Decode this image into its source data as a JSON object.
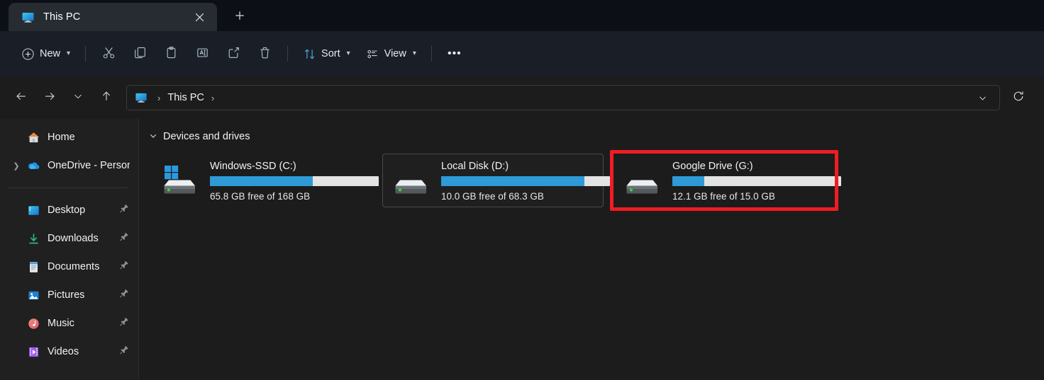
{
  "window": {
    "tab_title": "This PC",
    "tab_icon": "this-pc-monitor-icon",
    "close_icon": "close-icon",
    "new_tab_icon": "plus-icon"
  },
  "toolbar": {
    "new_label": "New",
    "sort_label": "Sort",
    "view_label": "View",
    "buttons": [
      {
        "name": "cut-button",
        "icon": "scissors-icon"
      },
      {
        "name": "copy-button",
        "icon": "copy-icon"
      },
      {
        "name": "paste-button",
        "icon": "paste-icon"
      },
      {
        "name": "rename-button",
        "icon": "rename-icon"
      },
      {
        "name": "share-button",
        "icon": "share-icon"
      },
      {
        "name": "delete-button",
        "icon": "trash-icon"
      }
    ],
    "overflow_label": "•••"
  },
  "address_bar": {
    "back_icon": "arrow-left-icon",
    "forward_icon": "arrow-right-icon",
    "recent_icon": "chevron-down-icon",
    "up_icon": "arrow-up-icon",
    "location_icon": "this-pc-monitor-icon",
    "crumbs": [
      "This PC"
    ],
    "separator": "›",
    "dropdown_icon": "chevron-down-icon",
    "refresh_icon": "refresh-icon"
  },
  "sidebar": {
    "items": [
      {
        "label": "Home",
        "icon": "home-icon",
        "expander": false,
        "pinned": false
      },
      {
        "label": "OneDrive - Persona",
        "icon": "onedrive-cloud-icon",
        "expander": true,
        "pinned": false
      },
      {
        "divider": true
      },
      {
        "label": "Desktop",
        "icon": "desktop-icon",
        "expander": false,
        "pinned": true
      },
      {
        "label": "Downloads",
        "icon": "downloads-icon",
        "expander": false,
        "pinned": true
      },
      {
        "label": "Documents",
        "icon": "documents-icon",
        "expander": false,
        "pinned": true
      },
      {
        "label": "Pictures",
        "icon": "pictures-icon",
        "expander": false,
        "pinned": true
      },
      {
        "label": "Music",
        "icon": "music-icon",
        "expander": false,
        "pinned": true
      },
      {
        "label": "Videos",
        "icon": "videos-icon",
        "expander": false,
        "pinned": true
      }
    ]
  },
  "main": {
    "group_title": "Devices and drives",
    "group_expanded": true,
    "drives": [
      {
        "name": "Windows-SSD (C:)",
        "space_text": "65.8 GB free of 168 GB",
        "used_percent": 61,
        "icon": "windows-drive-icon",
        "selected": false,
        "highlighted": false
      },
      {
        "name": "Local Disk (D:)",
        "space_text": "10.0 GB free of 68.3 GB",
        "used_percent": 85,
        "icon": "local-drive-icon",
        "selected": true,
        "highlighted": false
      },
      {
        "name": "Google Drive (G:)",
        "space_text": "12.1 GB free of 15.0 GB",
        "used_percent": 19,
        "icon": "local-drive-icon",
        "selected": false,
        "highlighted": true
      }
    ]
  },
  "colors": {
    "bar_fill": "#2e9ad6",
    "bar_track": "#e3e3e3",
    "highlight_box": "#f01c24",
    "accent_blue": "#2e9ad6"
  }
}
